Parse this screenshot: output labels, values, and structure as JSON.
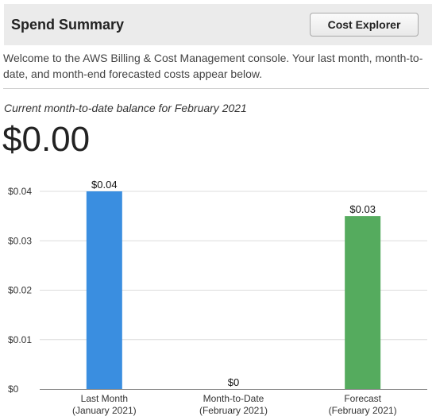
{
  "header": {
    "title": "Spend Summary",
    "button_label": "Cost Explorer"
  },
  "welcome_text": "Welcome to the AWS Billing & Cost Management console. Your last month, month-to-date, and month-end forecasted costs appear below.",
  "balance": {
    "caption": "Current month-to-date balance for February 2021",
    "amount": "$0.00"
  },
  "chart_data": {
    "type": "bar",
    "categories": [
      [
        "Last Month",
        "(January 2021)"
      ],
      [
        "Month-to-Date",
        "(February 2021)"
      ],
      [
        "Forecast",
        "(February 2021)"
      ]
    ],
    "values": [
      0.04,
      0,
      0.035
    ],
    "data_labels": [
      "$0.04",
      "$0",
      "$0.03"
    ],
    "colors": [
      "#3a8ee0",
      "#3a8ee0",
      "#55ab5e"
    ],
    "y_ticks": [
      0,
      0.01,
      0.02,
      0.03,
      0.04
    ],
    "y_tick_labels": [
      "$0",
      "$0.01",
      "$0.02",
      "$0.03",
      "$0.04"
    ],
    "ylim": [
      0,
      0.04
    ],
    "grid": true
  }
}
